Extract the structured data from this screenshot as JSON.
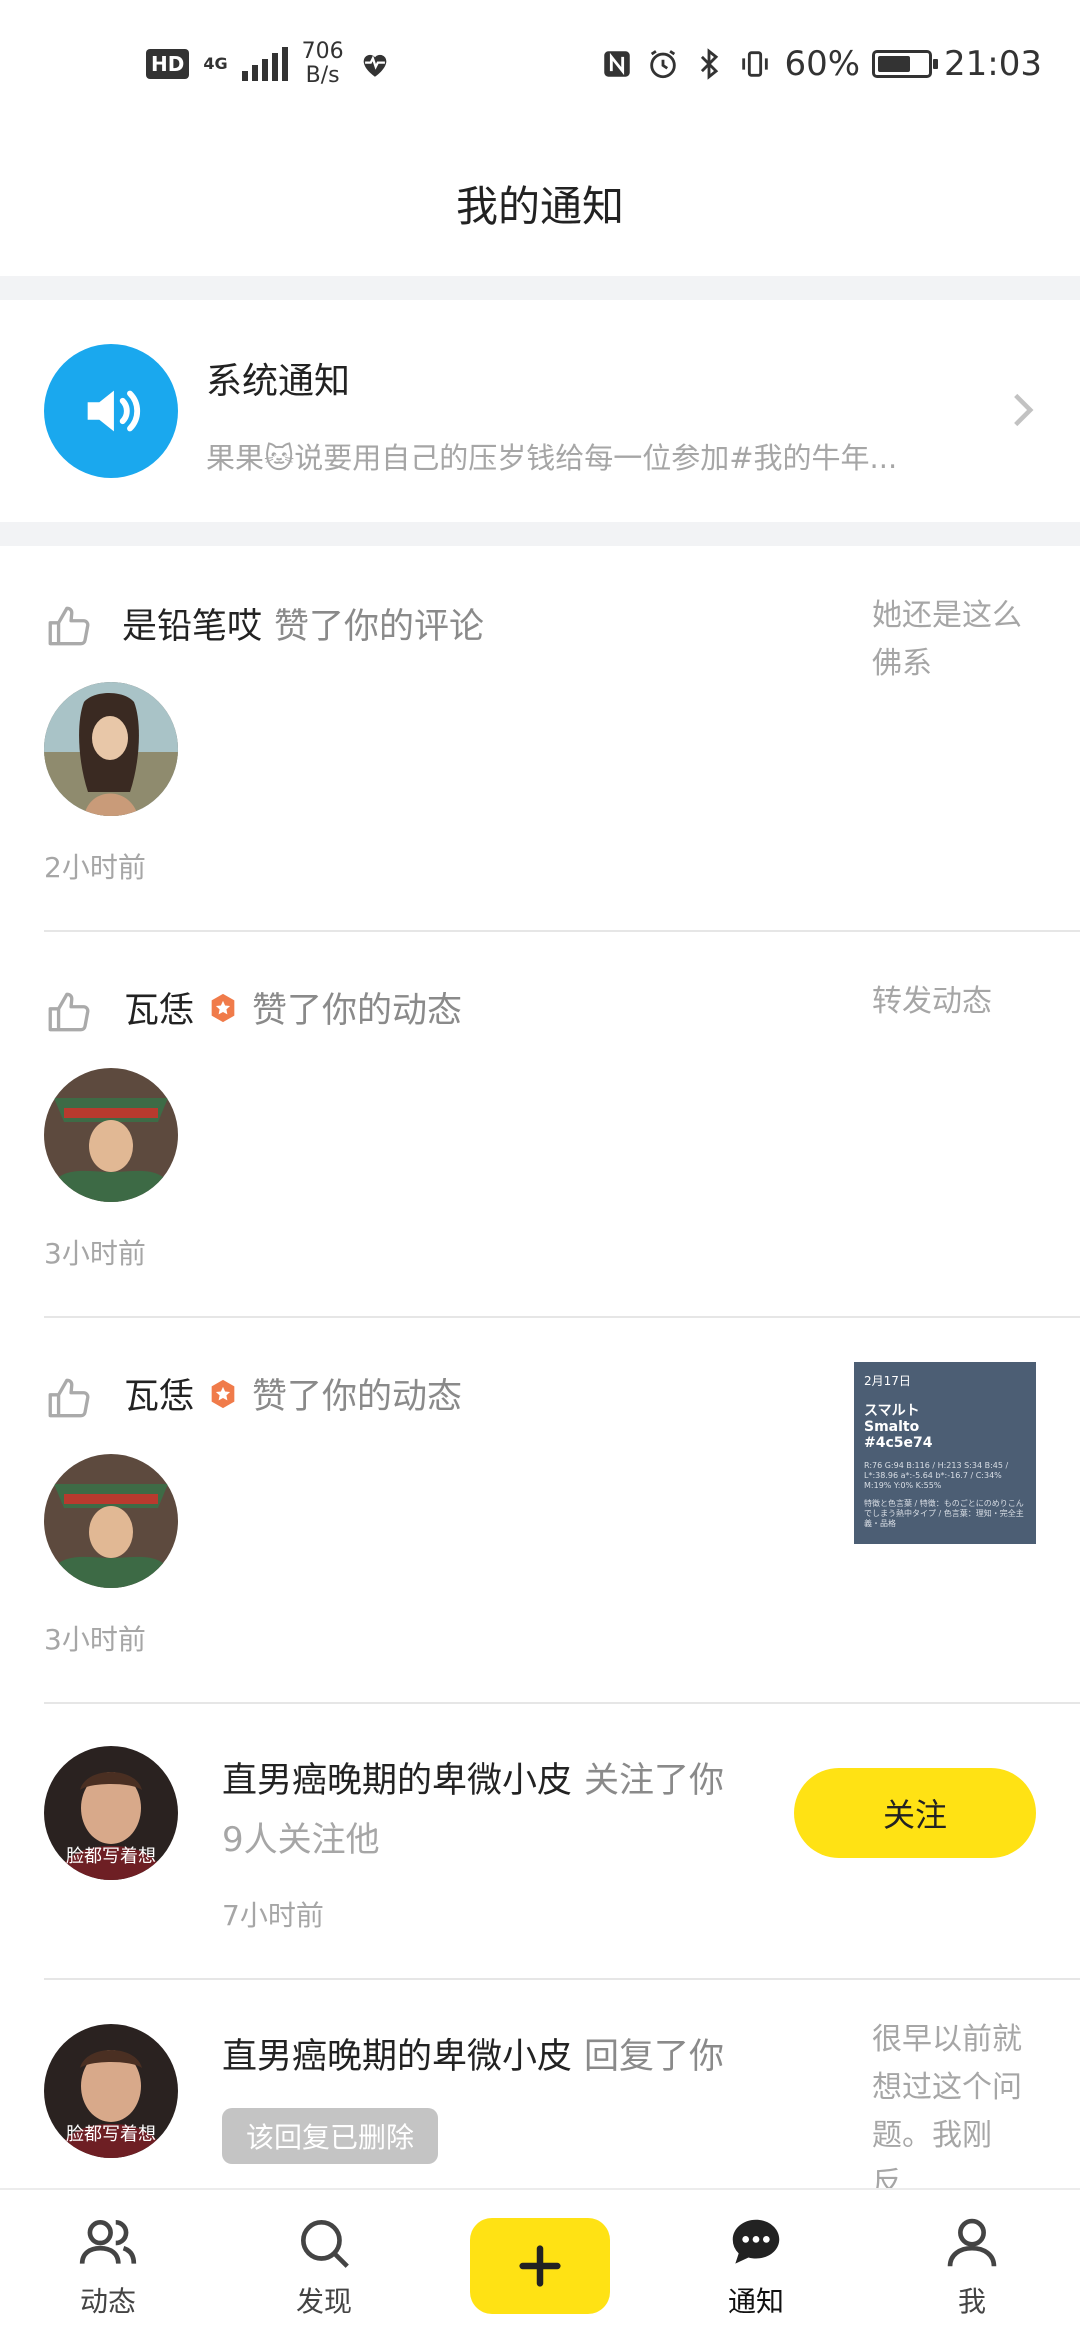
{
  "status_bar": {
    "hd": "HD",
    "network": "4G",
    "speed_value": "706",
    "speed_unit": "B/s",
    "battery": "60%",
    "time": "21:03"
  },
  "header": {
    "title": "我的通知"
  },
  "system_notice": {
    "title": "系统通知",
    "preview": "果果🐱说要用自己的压岁钱给每一位参加#我的牛年...",
    "avatar_color": "#1aa8ee"
  },
  "notifications": [
    {
      "user": "是铅笔哎",
      "action": "赞了你的评论",
      "ref": "她还是这么佛系",
      "time": "2小时前"
    },
    {
      "user": "瓦恁",
      "action": "赞了你的动态",
      "ref": "转发动态",
      "time": "3小时前"
    },
    {
      "user": "瓦恁",
      "action": "赞了你的动态",
      "time": "3小时前",
      "thumb": {
        "date": "2月17日",
        "name_jp": "スマルト",
        "name_en": "Smalto",
        "hex": "#4c5e74",
        "specs": "R:76 G:94 B:116 / H:213 S:34 B:45 / L*:38.96 a*:-5.64 b*:-16.7 / C:34% M:19% Y:0% K:55%",
        "note": "特徴と色言葉 / 特徴：ものごとにのめりこんでしまう熱中タイプ / 色言葉：理知・完全主義・品格"
      }
    },
    {
      "user": "直男癌晚期的卑微小皮",
      "action": "关注了你",
      "sub": "9人关注他",
      "time": "7小时前",
      "button": "关注",
      "avatar_caption": "脸都写着想"
    },
    {
      "user": "直男癌晚期的卑微小皮",
      "action": "回复了你",
      "deleted_label": "该回复已删除",
      "ref": "很早以前就想过这个问题。我刚反...",
      "avatar_caption": "脸都写着想"
    }
  ],
  "bottom_nav": {
    "items": [
      {
        "label": "动态",
        "icon": "users-icon"
      },
      {
        "label": "发现",
        "icon": "search-icon"
      },
      {
        "label": "",
        "icon": "plus-icon"
      },
      {
        "label": "通知",
        "icon": "chat-icon"
      },
      {
        "label": "我",
        "icon": "person-icon"
      }
    ],
    "accent": "#ffe214"
  }
}
